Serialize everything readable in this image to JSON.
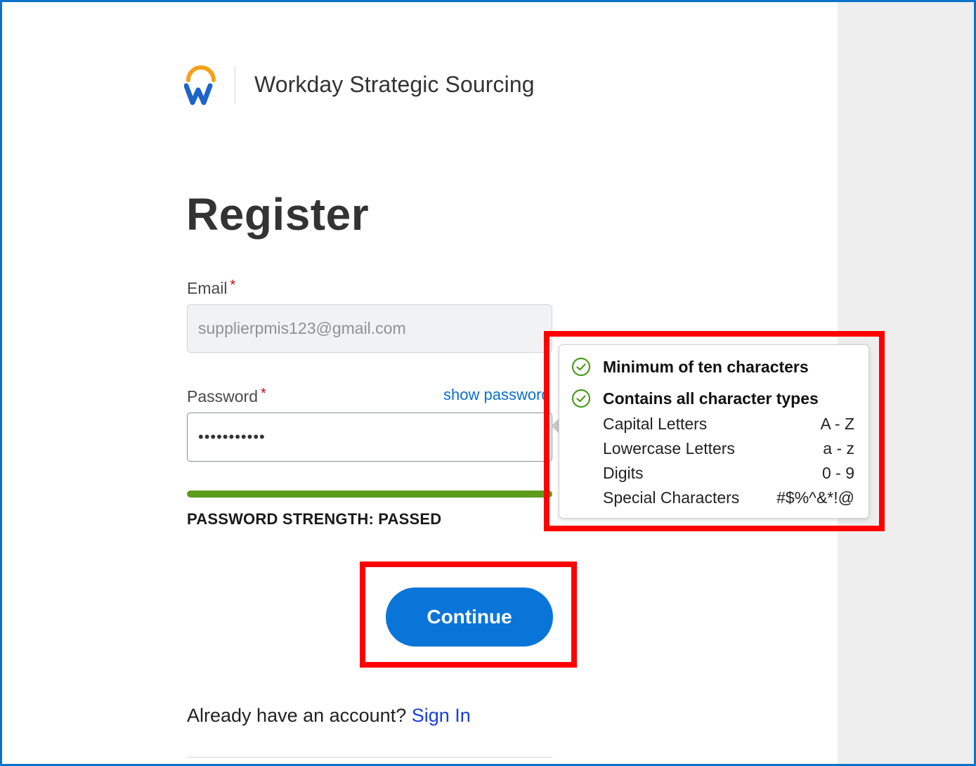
{
  "header": {
    "app_name": "Workday Strategic Sourcing",
    "logo_icon": "workday-logo-icon"
  },
  "page": {
    "title": "Register"
  },
  "form": {
    "email_label": "Email",
    "email_required_mark": "*",
    "email_value": "supplierpmis123@gmail.com",
    "password_label": "Password",
    "password_required_mark": "*",
    "show_password_label": "show password",
    "password_value": "•••••••••••",
    "strength_text": "PASSWORD STRENGTH: PASSED",
    "strength_level": 1.0
  },
  "password_rules": {
    "rules": [
      {
        "label": "Minimum of ten characters",
        "status": "passed",
        "icon": "check-circle-icon"
      },
      {
        "label": "Contains all character types",
        "status": "passed",
        "icon": "check-circle-icon"
      }
    ],
    "character_types": [
      {
        "name": "Capital Letters",
        "range": "A - Z"
      },
      {
        "name": "Lowercase Letters",
        "range": "a - z"
      },
      {
        "name": "Digits",
        "range": "0 - 9"
      },
      {
        "name": "Special Characters",
        "range": "#$%^&*!@"
      }
    ]
  },
  "actions": {
    "continue_label": "Continue"
  },
  "footer": {
    "account_prompt": "Already have an account?",
    "sign_in_label": "Sign In"
  },
  "colors": {
    "accent": "#0a75d9",
    "success": "#5b9b1e",
    "highlight": "#ff0000",
    "frame": "#0a72c9"
  }
}
